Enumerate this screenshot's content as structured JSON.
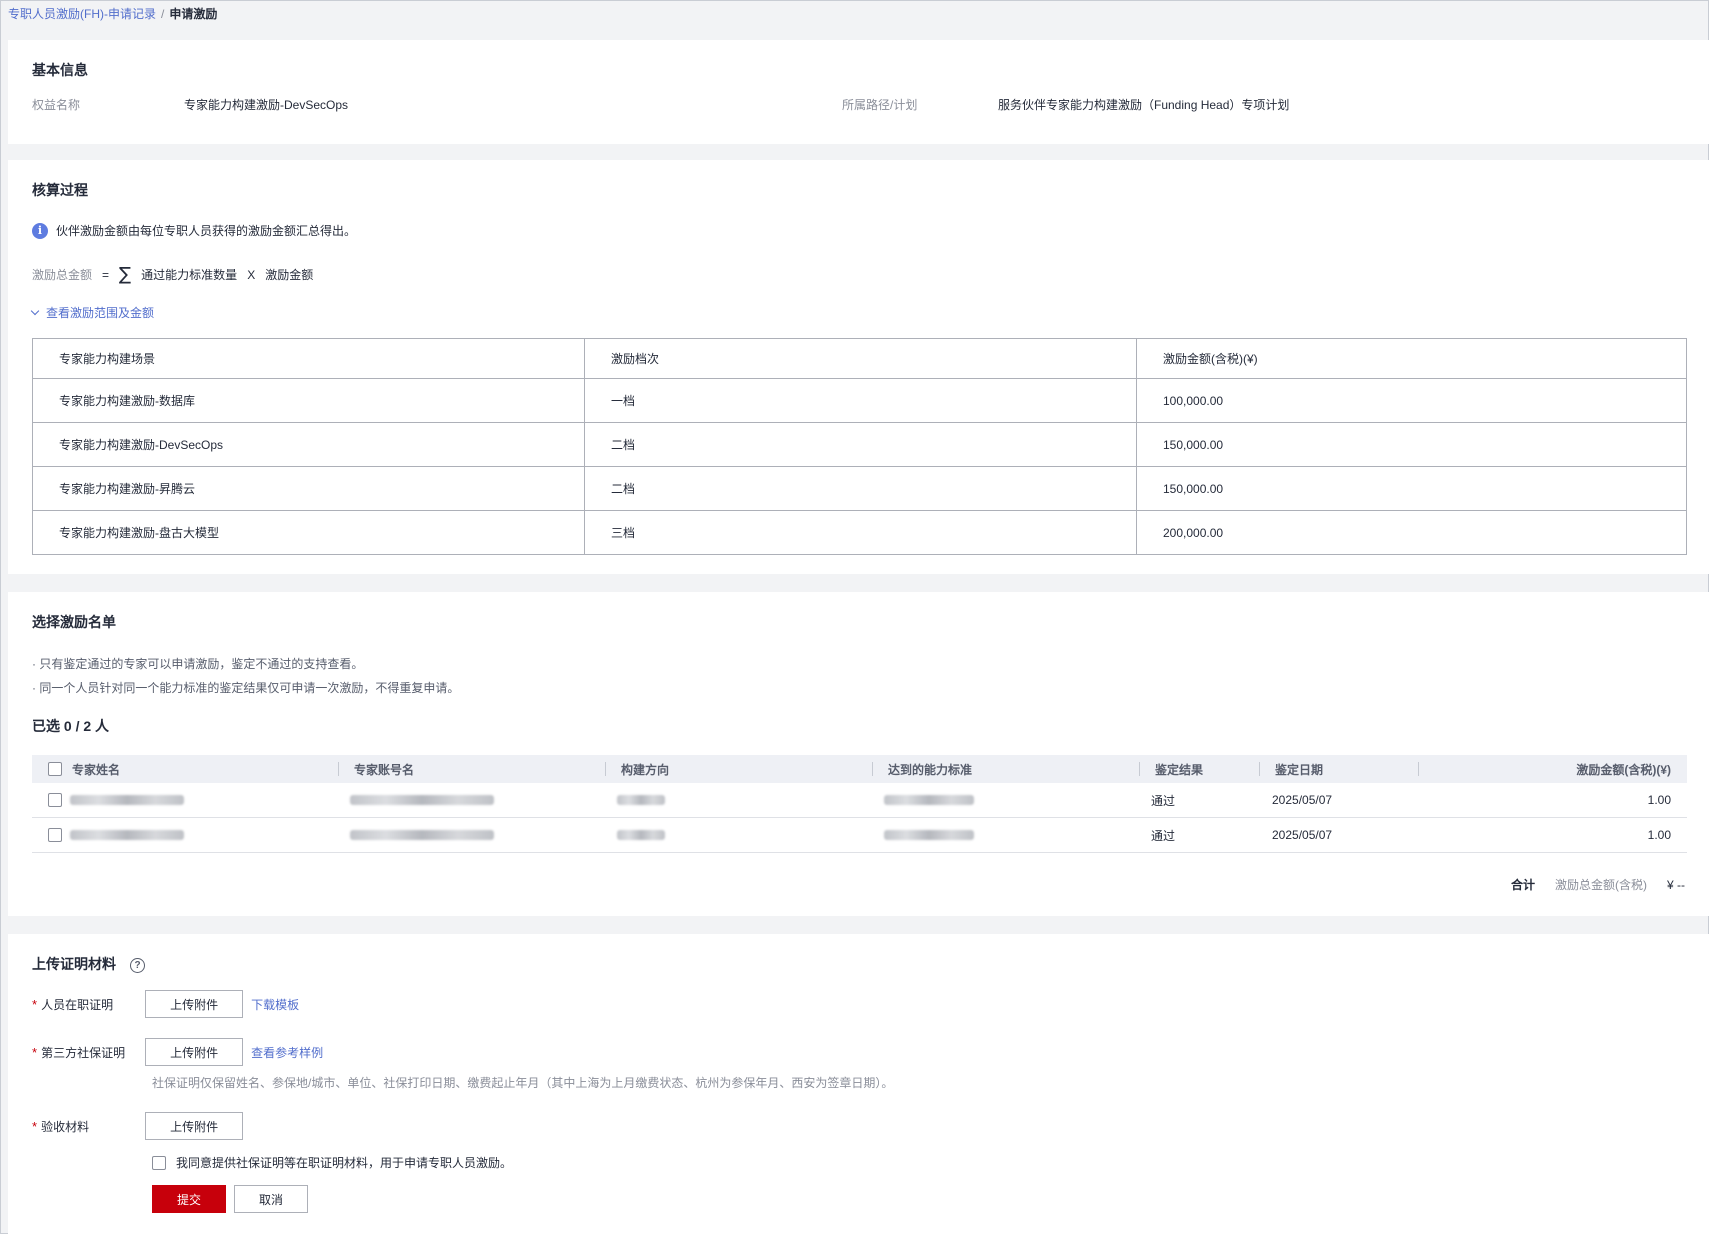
{
  "breadcrumb": {
    "parent": "专职人员激励(FH)-申请记录",
    "separator": "/",
    "current": "申请激励"
  },
  "basic": {
    "title": "基本信息",
    "rights_label": "权益名称",
    "rights_value": "专家能力构建激励-DevSecOps",
    "path_label": "所属路径/计划",
    "path_value": "服务伙伴专家能力构建激励（Funding Head）专项计划"
  },
  "calc": {
    "title": "核算过程",
    "info": "伙伴激励金额由每位专职人员获得的激励金额汇总得出。",
    "formula": {
      "lhs": "激励总金额",
      "eq": "=",
      "sigma": "∑",
      "term1": "通过能力标准数量",
      "times": "X",
      "term2": "激励金额"
    },
    "toggle": "查看激励范围及金额",
    "table": {
      "headers": [
        "专家能力构建场景",
        "激励档次",
        "激励金额(含税)(¥)"
      ],
      "rows": [
        [
          "专家能力构建激励-数据库",
          "一档",
          "100,000.00"
        ],
        [
          "专家能力构建激励-DevSecOps",
          "二档",
          "150,000.00"
        ],
        [
          "专家能力构建激励-昇腾云",
          "二档",
          "150,000.00"
        ],
        [
          "专家能力构建激励-盘古大模型",
          "三档",
          "200,000.00"
        ]
      ]
    }
  },
  "list": {
    "title": "选择激励名单",
    "note1": "· 只有鉴定通过的专家可以申请激励，鉴定不通过的支持查看。",
    "note2": "· 同一个人员针对同一个能力标准的鉴定结果仅可申请一次激励，不得重复申请。",
    "selected": "已选 0 / 2 人",
    "headers": {
      "name": "专家姓名",
      "account": "专家账号名",
      "direction": "构建方向",
      "standard": "达到的能力标准",
      "result": "鉴定结果",
      "date": "鉴定日期",
      "amount": "激励金额(含税)(¥)"
    },
    "rows": [
      {
        "result": "通过",
        "date": "2025/05/07",
        "amount": "1.00"
      },
      {
        "result": "通过",
        "date": "2025/05/07",
        "amount": "1.00"
      }
    ],
    "total_label": "合计",
    "total_caption": "激励总金额(含税)",
    "total_value": "¥ --"
  },
  "upload": {
    "title": "上传证明材料",
    "help": "?",
    "employment_label": "人员在职证明",
    "social_label": "第三方社保证明",
    "accept_label": "验收材料",
    "upload_btn": "上传附件",
    "download_template": "下载模板",
    "view_sample": "查看参考样例",
    "social_hint": "社保证明仅保留姓名、参保地/城市、单位、社保打印日期、缴费起止年月（其中上海为上月缴费状态、杭州为参保年月、西安为签章日期）。",
    "agree": "我同意提供社保证明等在职证明材料，用于申请专职人员激励。",
    "submit": "提交",
    "cancel": "取消",
    "required_mark": "*"
  },
  "colors": {
    "primary": "#c7000b",
    "link": "#526ecc",
    "info": "#5e7ce0"
  }
}
